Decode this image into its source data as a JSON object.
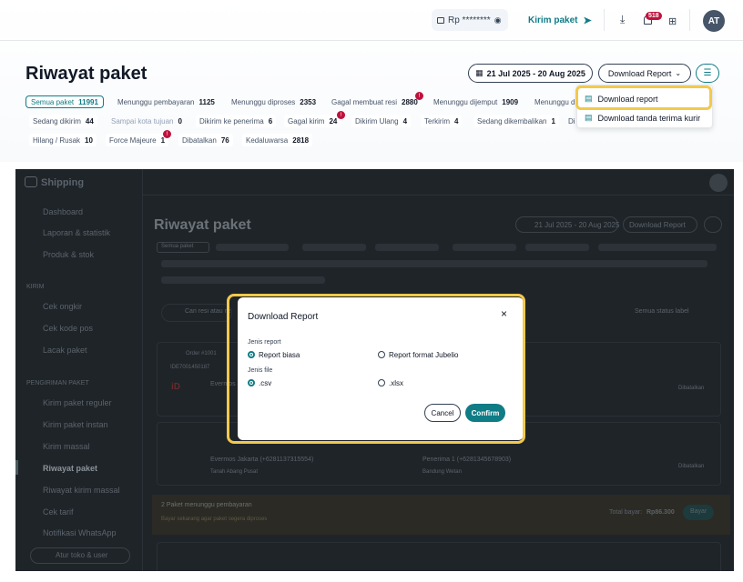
{
  "header": {
    "balance": "Rp ********",
    "kirim_paket": "Kirim paket",
    "bell_count": "518",
    "avatar": "AT"
  },
  "page_title": "Riwayat paket",
  "date_range": "21 Jul 2025 - 20 Aug 2025",
  "download_report_button": "Download Report",
  "dropdown": {
    "items": [
      "Download report",
      "Download tanda terima kurir"
    ]
  },
  "filters": [
    {
      "label": "Semua paket",
      "count": "11991"
    },
    {
      "label": "Menunggu pembayaran",
      "count": "1125"
    },
    {
      "label": "Menunggu diproses",
      "count": "2353"
    },
    {
      "label": "Gagal membuat resi",
      "count": "2880",
      "alert": "!"
    },
    {
      "label": "Menunggu dijemput",
      "count": "1909"
    },
    {
      "label": "Menunggu di",
      "count": ""
    },
    {
      "label": "Sedang dikirim",
      "count": "44"
    },
    {
      "label": "Sampai kota tujuan",
      "count": "0"
    },
    {
      "label": "Dikirim ke penerima",
      "count": "6"
    },
    {
      "label": "Gagal kirim",
      "count": "24",
      "alert": "!"
    },
    {
      "label": "Dikirim Ulang",
      "count": "4"
    },
    {
      "label": "Terkirim",
      "count": "4"
    },
    {
      "label": "Sedang dikembalikan",
      "count": "1"
    },
    {
      "label": "Di",
      "count": ""
    },
    {
      "label": "Hilang / Rusak",
      "count": "10"
    },
    {
      "label": "Force Majeure",
      "count": "1",
      "alert": "!"
    },
    {
      "label": "Dibatalkan",
      "count": "76"
    },
    {
      "label": "Kedaluwarsa",
      "count": "2818"
    }
  ],
  "background": {
    "logo": "Shipping",
    "sidebar": [
      "Dashboard",
      "Laporan & statistik",
      "Produk & stok",
      "Cek ongkir",
      "Cek kode pos",
      "Lacak paket",
      "Kirim paket reguler",
      "Kirim paket instan",
      "Kirim massal",
      "Riwayat paket",
      "Riwayat kirim massal",
      "Cek tarif",
      "Notifikasi WhatsApp",
      "Atur toko & user"
    ],
    "sections": [
      "KIRIM",
      "PENGIRIMAN PAKET"
    ],
    "page_title": "Riwayat paket",
    "date_range": "21 Jul 2025 - 20 Aug 2025",
    "download_report_button": "Download Report",
    "filter_all": "Semua paket",
    "search_placeholder": "Cari resi atau nama penerima",
    "status_select": "Semua status label",
    "row1": {
      "order": "Order #1001",
      "resi": "IDE7001450187",
      "sender": "Evermos Jakarta",
      "action": "Dibatalkan"
    },
    "row2": {
      "sender": "Evermos Jakarta (+6281137315554)",
      "origin": "Tanah Abang Pusat",
      "receiver": "Penerima 1 (+6281345678903)",
      "dest": "Bandung Wetan",
      "action": "Dibatalkan"
    },
    "banner": {
      "title": "2 Paket menunggu pembayaran",
      "subtitle": "Bayar sekarang agar paket segera diproses",
      "total_label": "Total bayar:",
      "total": "Rp86.300",
      "button": "Bayar"
    }
  },
  "modal": {
    "title": "Download Report",
    "close": "×",
    "jenis_report": "Jenis report",
    "report_options": [
      "Report biasa",
      "Report format Jubelio"
    ],
    "jenis_file": "Jenis file",
    "file_options": [
      ".csv",
      ".xlsx"
    ],
    "cancel": "Cancel",
    "confirm": "Confirm"
  }
}
